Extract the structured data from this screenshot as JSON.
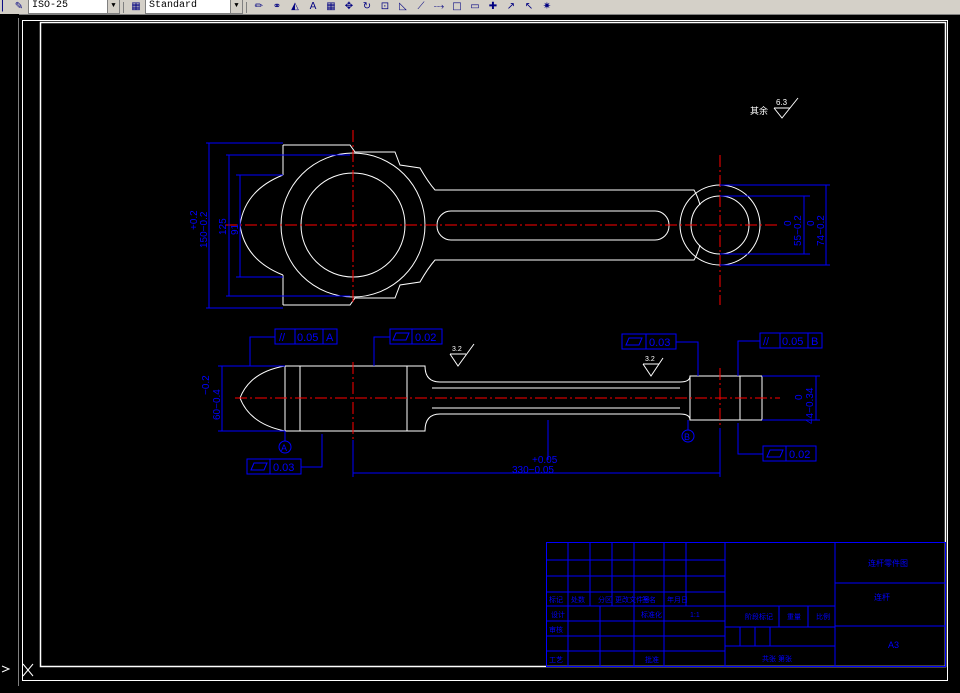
{
  "toolbar": {
    "dimstyle_value": "ISO-25",
    "textstyle_value": "Standard",
    "icons": [
      "pencil-icon",
      "link-icon",
      "triangle-icon",
      "text-icon",
      "grid-icon",
      "move-icon",
      "rotate-icon",
      "scale-icon",
      "mirror-icon",
      "linear-dim-icon",
      "aligned-dim-icon",
      "rectangle-icon",
      "box-icon",
      "cross-icon",
      "arrow-icon",
      "leader-icon",
      "sparkle-icon"
    ]
  },
  "colors": {
    "background": "#000000",
    "outline": "#ffffff",
    "centerline": "#ff0000",
    "dimension": "#0000ff"
  },
  "drawing": {
    "surface_note": "其余",
    "surface_note_value": "6.3",
    "roughness_1": "3.2",
    "roughness_2": "3.2",
    "dims": {
      "d_150": "150−0.2",
      "d_150_tol": "+0.2",
      "d_125": "125",
      "d_91": "91",
      "d_55": "55−0.2",
      "d_55_tol": "0",
      "d_74": "74−0.2",
      "d_74_tol": "0",
      "d_60": "60−0.4",
      "d_60_tol": "−0.2",
      "d_44": "44−0.34",
      "d_44_tol": "0",
      "d_330": "330−0.05",
      "d_330_tol": "+0.05"
    },
    "tolerances": {
      "parallel_a": "//",
      "parallel_a_val": "0.05",
      "parallel_a_ref": "A",
      "flat_1": "0.02",
      "flat_2": "0.03",
      "parallel_b": "//",
      "parallel_b_val": "0.05",
      "parallel_b_ref": "B",
      "flat_3": "0.02",
      "flat_4": "0.03"
    },
    "datum_a": "A",
    "datum_b": "B"
  },
  "title_block": {
    "row_labels": [
      "标记",
      "处数",
      "分区",
      "更改文件号",
      "签名",
      "年月日"
    ],
    "design": "设计",
    "standardize": "标准化",
    "stage": "阶段标记",
    "weight": "重量",
    "ratio": "比例",
    "review": "审核",
    "process": "工艺",
    "approve": "批准",
    "scale": "1:1",
    "sheet": "共张 第张",
    "name": "连杆",
    "part_name": "连杆零件图",
    "material": "",
    "paper_size": "A3"
  }
}
